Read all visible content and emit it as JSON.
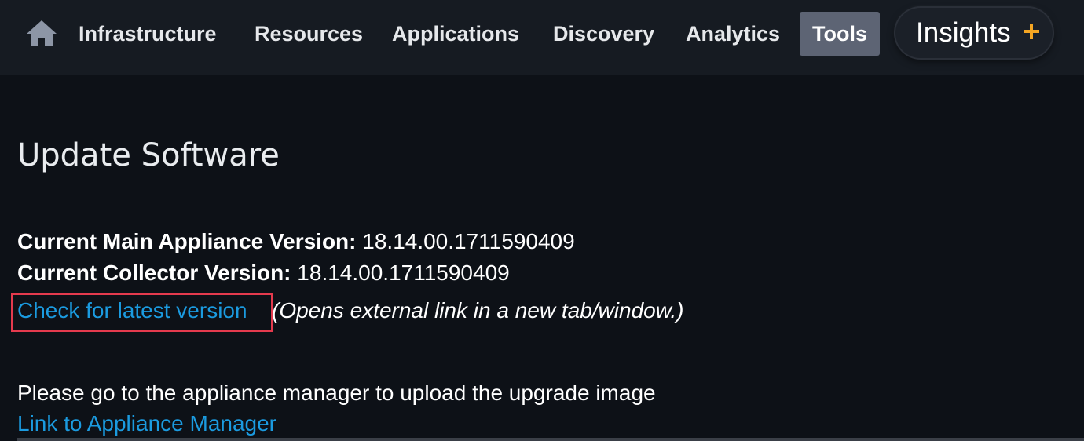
{
  "nav": {
    "home_icon": "home-icon",
    "items": [
      {
        "label": "Infrastructure",
        "active": false
      },
      {
        "label": "Resources",
        "active": false
      },
      {
        "label": "Applications",
        "active": false
      },
      {
        "label": "Discovery",
        "active": false
      },
      {
        "label": "Analytics",
        "active": false
      },
      {
        "label": "Tools",
        "active": true
      }
    ],
    "insights": {
      "label": "Insights",
      "plus_color": "#f5a623"
    }
  },
  "main": {
    "title": "Update Software",
    "main_version": {
      "label": "Current Main Appliance Version:",
      "value": "18.14.00.1711590409"
    },
    "collector_version": {
      "label": "Current Collector Version:",
      "value": "18.14.00.1711590409"
    },
    "check_link": "Check for latest version",
    "check_link_note": "(Opens external link in a new tab/window.)",
    "instructions": "Please go to the appliance manager to upload the upgrade image",
    "appliance_link": "Link to Appliance Manager"
  },
  "colors": {
    "background": "#0d1117",
    "navbar": "#161b22",
    "link": "#1b9be0",
    "active_tab": "#5d6474",
    "highlight": "#e43a4d"
  }
}
